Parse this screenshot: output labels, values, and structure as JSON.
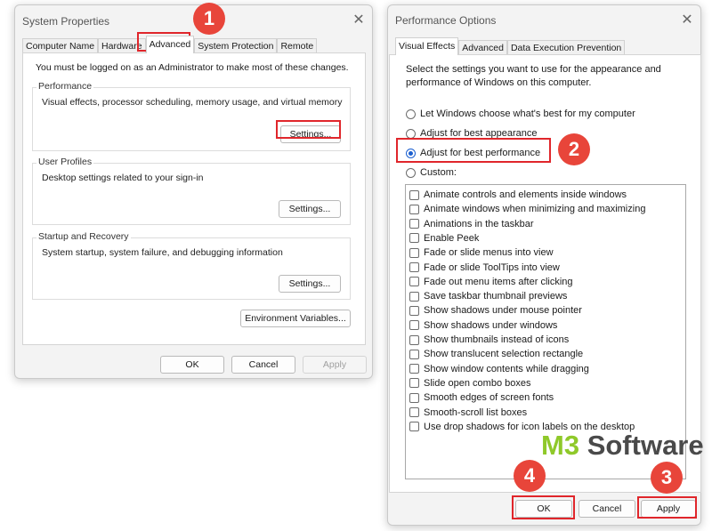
{
  "system_properties": {
    "title": "System Properties",
    "tabs": [
      "Computer Name",
      "Hardware",
      "Advanced",
      "System Protection",
      "Remote"
    ],
    "active_tab": "Advanced",
    "admin_note": "You must be logged on as an Administrator to make most of these changes.",
    "performance": {
      "label": "Performance",
      "description": "Visual effects, processor scheduling, memory usage, and virtual memory",
      "settings_label": "Settings..."
    },
    "user_profiles": {
      "label": "User Profiles",
      "description": "Desktop settings related to your sign-in",
      "settings_label": "Settings..."
    },
    "startup_recovery": {
      "label": "Startup and Recovery",
      "description": "System startup, system failure, and debugging information",
      "settings_label": "Settings..."
    },
    "env_vars_label": "Environment Variables...",
    "ok_label": "OK",
    "cancel_label": "Cancel",
    "apply_label": "Apply"
  },
  "performance_options": {
    "title": "Performance Options",
    "tabs": [
      "Visual Effects",
      "Advanced",
      "Data Execution Prevention"
    ],
    "active_tab": "Visual Effects",
    "instructions": [
      "Select the settings you want to use for the appearance and",
      "performance of Windows on this computer."
    ],
    "radios": [
      {
        "label": "Let Windows choose what's best for my computer",
        "checked": false
      },
      {
        "label": "Adjust for best appearance",
        "checked": false
      },
      {
        "label": "Adjust for best performance",
        "checked": true
      },
      {
        "label": "Custom:",
        "checked": false
      }
    ],
    "effects": [
      "Animate controls and elements inside windows",
      "Animate windows when minimizing and maximizing",
      "Animations in the taskbar",
      "Enable Peek",
      "Fade or slide menus into view",
      "Fade or slide ToolTips into view",
      "Fade out menu items after clicking",
      "Save taskbar thumbnail previews",
      "Show shadows under mouse pointer",
      "Show shadows under windows",
      "Show thumbnails instead of icons",
      "Show translucent selection rectangle",
      "Show window contents while dragging",
      "Slide open combo boxes",
      "Smooth edges of screen fonts",
      "Smooth-scroll list boxes",
      "Use drop shadows for icon labels on the desktop"
    ],
    "ok_label": "OK",
    "cancel_label": "Cancel",
    "apply_label": "Apply"
  },
  "annotations": {
    "step1": "1",
    "step2": "2",
    "step3": "3",
    "step4": "4",
    "badge_color": "#e8453a",
    "highlight_color": "#e0262b"
  },
  "watermark": {
    "brand_a": "M3",
    "brand_b": " Software"
  }
}
